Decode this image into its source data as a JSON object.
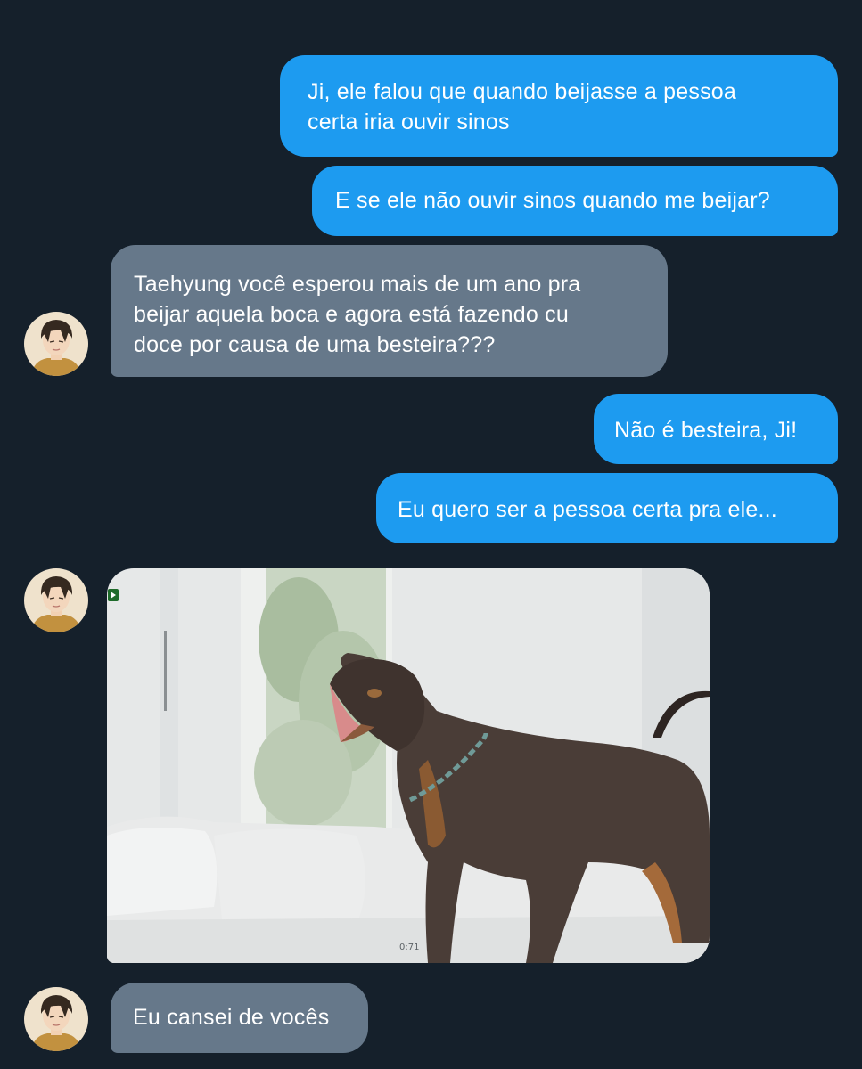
{
  "conversation": {
    "messages": [
      {
        "sender": "self",
        "text": "Ji, ele falou que quando beijasse a pessoa certa iria ouvir sinos",
        "lines": [
          "Ji, ele falou que quando beijasse a pessoa",
          "certa iria ouvir sinos"
        ]
      },
      {
        "sender": "self",
        "text": "E se ele não ouvir sinos quando me beijar?"
      },
      {
        "sender": "contact",
        "text": "Taehyung você esperou mais de um ano pra beijar aquela boca e agora está fazendo cu doce por causa de uma besteira???",
        "lines": [
          "Taehyung você esperou mais de um ano pra",
          "beijar aquela boca e agora está fazendo cu",
          "doce por causa de uma besteira???"
        ]
      },
      {
        "sender": "self",
        "text": "Não é besteira, Ji!"
      },
      {
        "sender": "self",
        "text": "Eu quero ser a pessoa certa pra ele..."
      },
      {
        "sender": "contact",
        "type": "gif",
        "media_description": "doberman dog barking on a white sofa",
        "timestamp": "0:71"
      },
      {
        "sender": "contact",
        "text": "Eu cansei de vocês"
      }
    ]
  },
  "colors": {
    "background": "#15202b",
    "outgoing_bubble": "#1d9bf0",
    "incoming_bubble": "#66788a",
    "text": "#ffffff"
  },
  "icons": {
    "avatar": "contact-avatar-photo"
  }
}
